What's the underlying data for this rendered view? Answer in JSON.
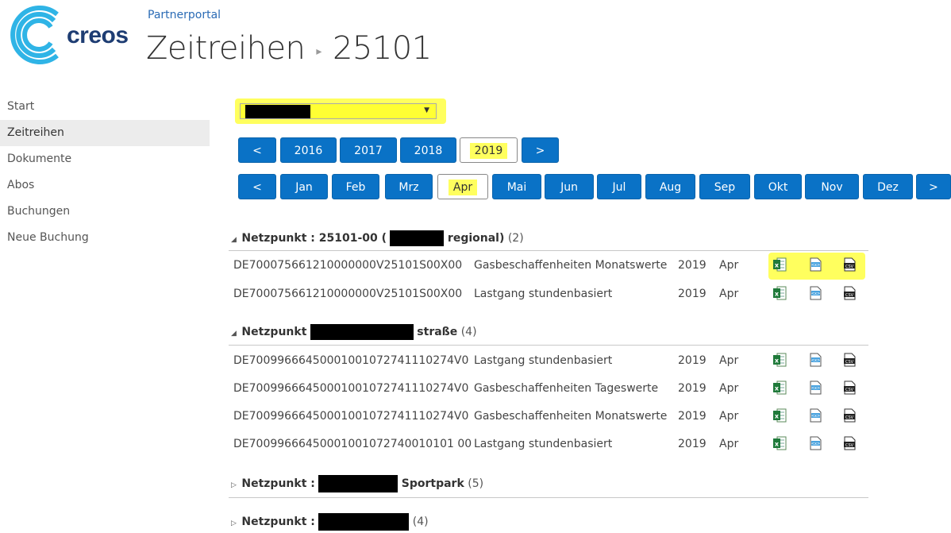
{
  "header": {
    "logo_text": "creos",
    "portal": "Partnerportal",
    "title": "Zeitreihen",
    "separator": "▸",
    "subtitle": "25101"
  },
  "sidebar": {
    "items": [
      {
        "label": "Start"
      },
      {
        "label": "Zeitreihen"
      },
      {
        "label": "Dokumente"
      },
      {
        "label": "Abos"
      },
      {
        "label": "Buchungen"
      },
      {
        "label": "Neue Buchung"
      }
    ]
  },
  "selector": {
    "arrow": "▼"
  },
  "years": {
    "prev": "<",
    "next": ">",
    "items": [
      "2016",
      "2017",
      "2018",
      "2019"
    ],
    "selected": "2019"
  },
  "months": {
    "prev": "<",
    "next": ">",
    "items": [
      "Jan",
      "Feb",
      "Mrz",
      "Apr",
      "Mai",
      "Jun",
      "Jul",
      "Aug",
      "Sep",
      "Okt",
      "Nov",
      "Dez"
    ],
    "selected": "Apr"
  },
  "groups": [
    {
      "triangle": "◢",
      "prefix": "Netzpunkt : 25101-00 (",
      "suffix": "regional)",
      "count": "(2)",
      "rows": [
        {
          "id": "DE700075661210000000V25101S00X00",
          "desc": "Gasbeschaffenheiten Monatswerte",
          "year": "2019",
          "month": "Apr"
        },
        {
          "id": "DE700075661210000000V25101S00X00",
          "desc": "Lastgang stundenbasiert",
          "year": "2019",
          "month": "Apr"
        }
      ]
    },
    {
      "triangle": "◢",
      "prefix": "Netzpunkt",
      "suffix": "straße",
      "count": "(4)",
      "rows": [
        {
          "id": "DE7009966645000100107274111027​4V0",
          "desc": "Lastgang stundenbasiert",
          "year": "2019",
          "month": "Apr"
        },
        {
          "id": "DE70099666450001001072741110274V0",
          "desc": "Gasbeschaffenheiten Tageswerte",
          "year": "2019",
          "month": "Apr"
        },
        {
          "id": "DE70099666450001001072741110274V0",
          "desc": "Gasbeschaffenheiten Monatswerte",
          "year": "2019",
          "month": "Apr"
        },
        {
          "id": "DE70099666450001001072740010101 00",
          "desc": "Lastgang stundenbasiert",
          "year": "2019",
          "month": "Apr"
        }
      ]
    },
    {
      "triangle": "▷",
      "prefix": "Netzpunkt :",
      "suffix": "Sportpark",
      "count": "(5)",
      "rows": []
    },
    {
      "triangle": "▷",
      "prefix": "Netzpunkt :",
      "suffix": "",
      "count": "(4)",
      "rows": []
    }
  ],
  "icons": {
    "excel": "excel-icon",
    "xml": "xml-icon",
    "csv": "csv-icon",
    "excel_color": "#1f7a3a",
    "button_color": "#0a72c6",
    "highlight_color": "#ffff5e"
  }
}
